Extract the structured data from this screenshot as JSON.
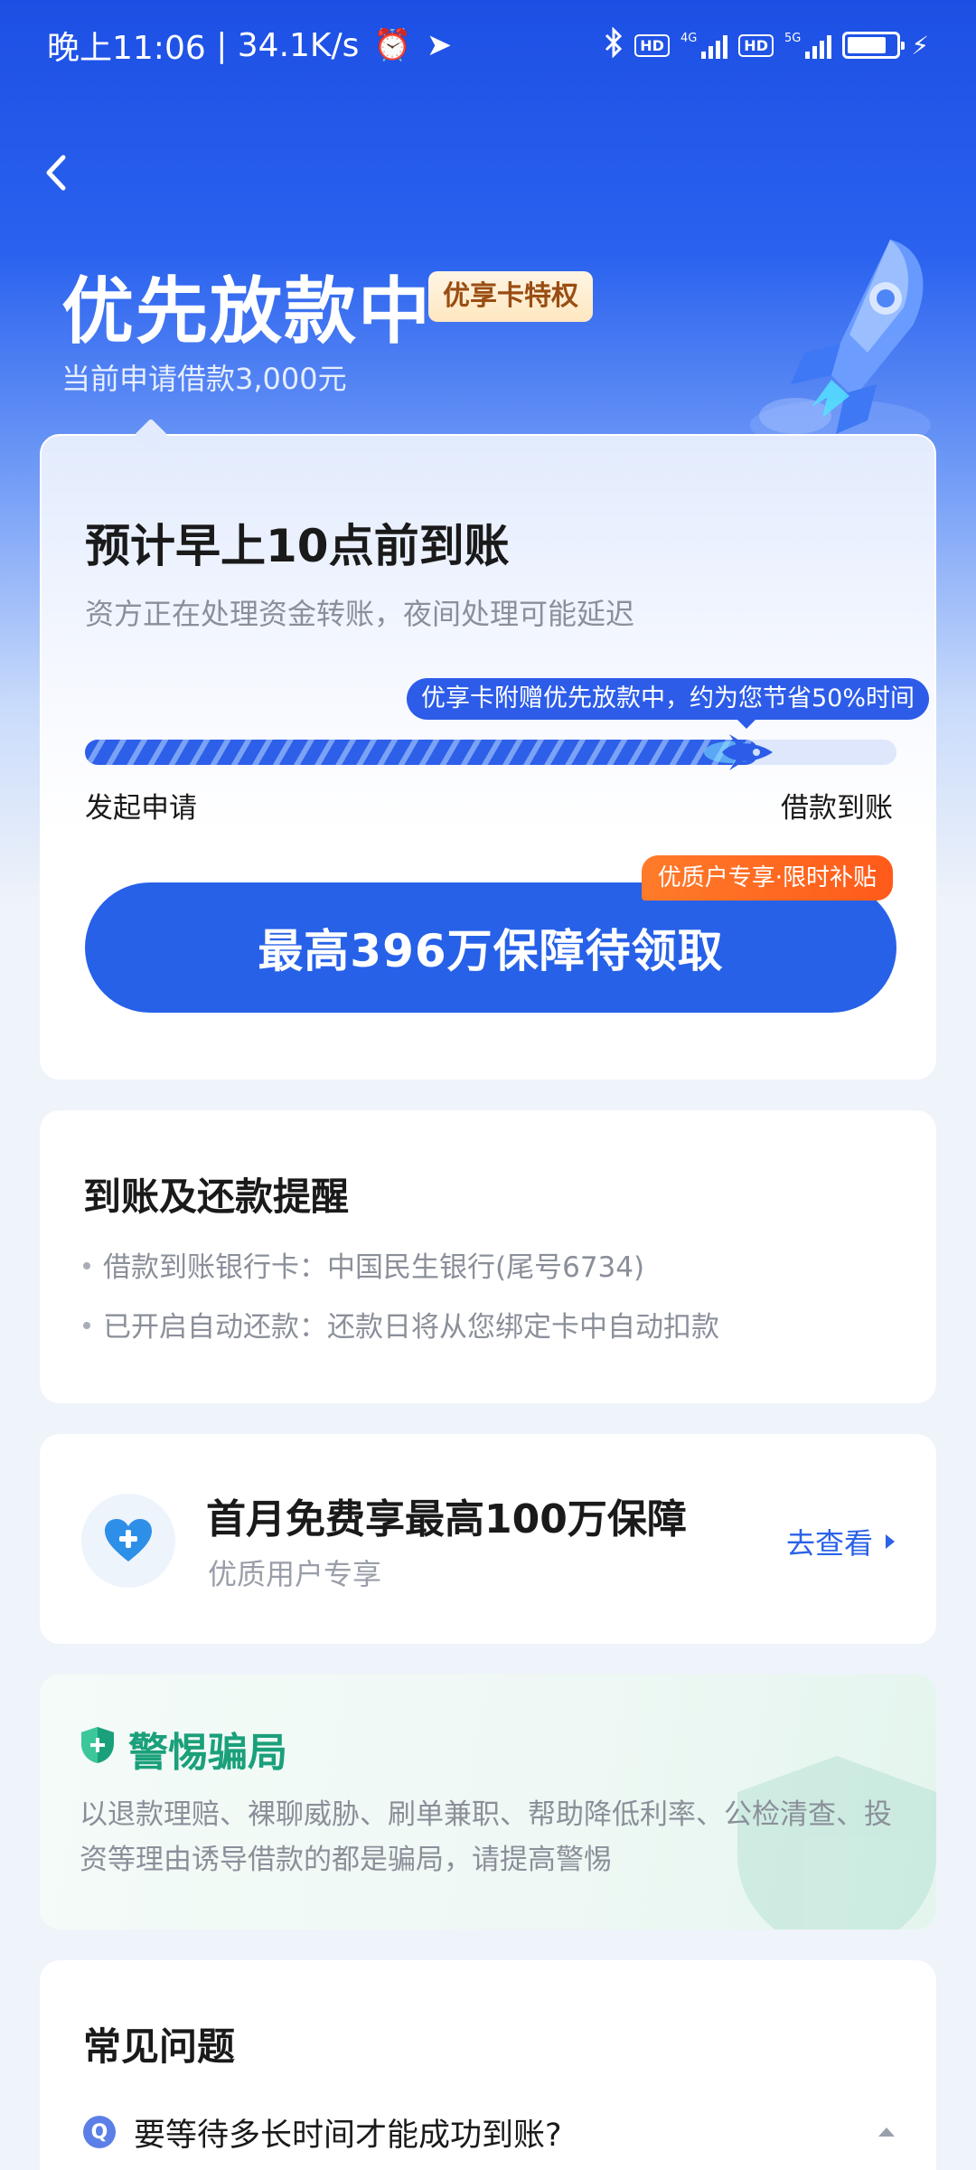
{
  "status_bar": {
    "time": "晚上11:06",
    "speed": "34.1K/s",
    "hd1": "HD",
    "net1": "4G",
    "hd2": "HD",
    "net2": "5G",
    "battery_level": 0.8
  },
  "header": {
    "title": "优先放款中",
    "badge": "优享卡特权",
    "subtitle": "当前申请借款3,000元"
  },
  "progress_card": {
    "eta_title": "预计早上10点前到账",
    "eta_subtitle": "资方正在处理资金转账，夜间处理可能延迟",
    "tooltip": "优享卡附赠优先放款中，约为您节省50%时间",
    "progress": 0.83,
    "step_start": "发起申请",
    "step_end": "借款到账",
    "claim_button": "最高396万保障待领取",
    "claim_tag": "优质户专享·限时补贴"
  },
  "reminder_card": {
    "title": "到账及还款提醒",
    "items": [
      "借款到账银行卡：中国民生银行(尾号6734)",
      "已开启自动还款：还款日将从您绑定卡中自动扣款"
    ]
  },
  "insurance_card": {
    "title": "首月免费享最高100万保障",
    "subtitle": "优质用户专享",
    "link": "去查看"
  },
  "fraud_card": {
    "title": "警惕骗局",
    "text": "以退款理赔、裸聊威胁、刷单兼职、帮助降低利率、公检清查、投资等理由诱导借款的都是骗局，请提高警惕"
  },
  "faq_card": {
    "title": "常见问题",
    "q_badge": "Q",
    "question": "要等待多长时间才能成功到账?"
  },
  "colors": {
    "brand": "#2761e8",
    "orange": "#ff6a20",
    "fraud_green": "#1aa07b"
  },
  "icons": {
    "back": "back-arrow-icon",
    "alarm": "alarm-icon",
    "location": "location-arrow-icon",
    "bluetooth": "bluetooth-icon",
    "heart": "heart-plus-icon",
    "shield": "shield-icon",
    "rocket": "rocket-icon"
  }
}
